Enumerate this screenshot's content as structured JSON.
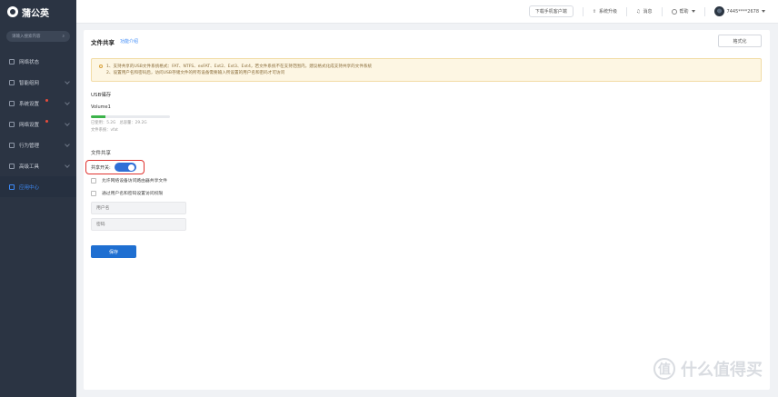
{
  "app": {
    "logo_text": "蒲公英"
  },
  "sidebar": {
    "search_placeholder": "请输入搜索内容",
    "items": [
      {
        "label": "网络状态"
      },
      {
        "label": "智能组网"
      },
      {
        "label": "系统设置"
      },
      {
        "label": "网络设置"
      },
      {
        "label": "行为管理"
      },
      {
        "label": "高级工具"
      },
      {
        "label": "应用中心"
      }
    ]
  },
  "topbar": {
    "download_label": "下载手机客户端",
    "upgrade_label": "系统升级",
    "messages_label": "消息",
    "help_label": "帮助",
    "account_label": "7445****2678"
  },
  "main": {
    "title": "文件共享",
    "guide_link": "功能介绍",
    "format_button": "格式化",
    "notice_lines": [
      "1、支持共享的USB文件系统格式：FAT、NTFS、exFAT、Ext2、Ext3、Ext4，若文件系统不在支持范围内，建议格式化成支持共享的文件系统",
      "2、设置用户名和密码后，访问USB存储文件的所有设备需要输入所设置的用户名和密码才可访问"
    ],
    "usb_section_title": "USB储存",
    "volume_name": "Volume1",
    "used_label": "已使用：",
    "used_value": "5.2G",
    "total_label": "总容量：",
    "total_value": "29.2G",
    "fs_label": "文件系统：",
    "fs_value": "vfat",
    "usage_fraction": 0.18,
    "share_section_title": "文件共享",
    "share_switch_label": "共享开关:",
    "share_enabled": true,
    "checkbox1_label": "允许网络设备访问路由器共享文件",
    "checkbox2_label": "通过用户名和密码设置访问权限",
    "username_placeholder": "用户名",
    "password_placeholder": "密码",
    "save_button": "保存"
  },
  "watermark": {
    "text": "什么值得买",
    "icon_char": "值"
  }
}
